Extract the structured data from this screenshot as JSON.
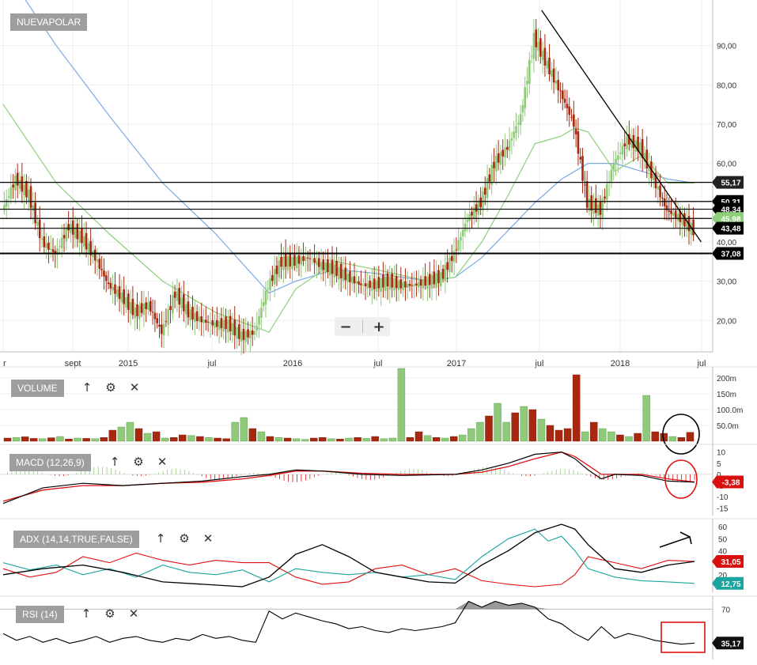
{
  "instrument": "NUEVAPOLAR",
  "colors": {
    "up": "#8fc97a",
    "down": "#a8280f",
    "sma_green": "#8cd07a",
    "sma_blue": "#79a9e6",
    "macd_line": "#000000",
    "signal_line": "#e01010",
    "adx_line": "#000000",
    "di_plus": "#1aa5a0",
    "di_minus": "#e01010",
    "rsi_line": "#000000",
    "annotation_black": "#000000",
    "annotation_red": "#e01010"
  },
  "panels": {
    "volume": {
      "label": "VOLUME"
    },
    "macd": {
      "label": "MACD (12,26,9)"
    },
    "adx": {
      "label": "ADX (14,14,TRUE,FALSE)"
    },
    "rsi": {
      "label": "RSI (14)"
    }
  },
  "toolbar": {
    "move_icon": "arrow-up-icon",
    "settings_icon": "gear-icon",
    "close_icon": "close-icon",
    "zoom_out": "−",
    "zoom_in": "+"
  },
  "chart_data": [
    {
      "name": "price",
      "type": "candlestick",
      "x_axis_labels": [
        "r",
        "sept",
        "2015",
        "jul",
        "2016",
        "jul",
        "2017",
        "jul",
        "2018",
        "jul"
      ],
      "y_ticks": [
        "20,00",
        "30,00",
        "40,00",
        "50,00",
        "60,00",
        "70,00",
        "80,00",
        "90,00"
      ],
      "ylim": [
        12,
        100
      ],
      "horizontal_levels": [
        {
          "value": 55.17,
          "label": "55,17"
        },
        {
          "value": 50.31,
          "label": "50,31"
        },
        {
          "value": 48.34,
          "label": "48,34"
        },
        {
          "value": 45.98,
          "label": "45,98"
        },
        {
          "value": 43.48,
          "label": "43,48"
        },
        {
          "value": 37.08,
          "label": "37,08"
        }
      ],
      "price_points": [
        [
          0,
          48
        ],
        [
          1,
          56
        ],
        [
          2,
          52
        ],
        [
          3,
          40
        ],
        [
          4,
          37
        ],
        [
          5,
          44
        ],
        [
          6,
          41
        ],
        [
          7,
          36
        ],
        [
          8,
          29
        ],
        [
          9,
          26
        ],
        [
          10,
          22
        ],
        [
          11,
          24
        ],
        [
          12,
          17
        ],
        [
          13,
          27
        ],
        [
          14,
          22
        ],
        [
          15,
          20
        ],
        [
          16,
          19
        ],
        [
          17,
          19
        ],
        [
          18,
          16
        ],
        [
          19,
          17
        ],
        [
          20,
          29
        ],
        [
          21,
          35
        ],
        [
          22,
          35
        ],
        [
          23,
          36
        ],
        [
          24,
          34
        ],
        [
          25,
          33
        ],
        [
          26,
          31
        ],
        [
          27,
          29
        ],
        [
          28,
          29
        ],
        [
          29,
          30
        ],
        [
          30,
          29
        ],
        [
          31,
          29
        ],
        [
          32,
          30
        ],
        [
          33,
          31
        ],
        [
          34,
          37
        ],
        [
          35,
          46
        ],
        [
          36,
          50
        ],
        [
          37,
          60
        ],
        [
          38,
          64
        ],
        [
          39,
          72
        ],
        [
          40,
          92
        ],
        [
          41,
          85
        ],
        [
          42,
          78
        ],
        [
          43,
          70
        ],
        [
          44,
          50
        ],
        [
          45,
          48
        ],
        [
          46,
          60
        ],
        [
          47,
          66
        ],
        [
          48,
          64
        ],
        [
          49,
          56
        ],
        [
          50,
          48
        ],
        [
          51,
          46
        ],
        [
          52,
          43
        ]
      ],
      "sma_green": [
        [
          0,
          75
        ],
        [
          4,
          55
        ],
        [
          8,
          42
        ],
        [
          12,
          30
        ],
        [
          16,
          22
        ],
        [
          20,
          17
        ],
        [
          22,
          28
        ],
        [
          25,
          35
        ],
        [
          28,
          33
        ],
        [
          32,
          30
        ],
        [
          34,
          31
        ],
        [
          36,
          40
        ],
        [
          38,
          52
        ],
        [
          40,
          65
        ],
        [
          42,
          67
        ],
        [
          43,
          69
        ],
        [
          44,
          68
        ],
        [
          46,
          58
        ],
        [
          48,
          62
        ],
        [
          50,
          55
        ],
        [
          52,
          55
        ]
      ],
      "sma_blue": [
        [
          0,
          110
        ],
        [
          4,
          90
        ],
        [
          8,
          72
        ],
        [
          12,
          55
        ],
        [
          16,
          42
        ],
        [
          20,
          27
        ],
        [
          22,
          30
        ],
        [
          25,
          33
        ],
        [
          28,
          32
        ],
        [
          32,
          30
        ],
        [
          34,
          31
        ],
        [
          36,
          36
        ],
        [
          38,
          43
        ],
        [
          40,
          50
        ],
        [
          42,
          56
        ],
        [
          44,
          60
        ],
        [
          46,
          60
        ],
        [
          48,
          58
        ],
        [
          50,
          56
        ],
        [
          52,
          55
        ]
      ],
      "trendline": [
        [
          40.5,
          99
        ],
        [
          52.5,
          40
        ]
      ]
    },
    {
      "name": "volume",
      "type": "bar",
      "y_ticks": [
        "200m",
        "150m",
        "100.0m",
        "50.0m"
      ],
      "ylim": [
        0,
        220
      ],
      "values": [
        10,
        12,
        14,
        9,
        8,
        11,
        15,
        7,
        10,
        9,
        8,
        12,
        35,
        45,
        60,
        40,
        25,
        30,
        10,
        12,
        20,
        18,
        15,
        12,
        10,
        8,
        60,
        75,
        40,
        30,
        15,
        12,
        10,
        8,
        6,
        10,
        12,
        8,
        7,
        10,
        12,
        9,
        15,
        8,
        10,
        230,
        12,
        30,
        18,
        12,
        10,
        15,
        20,
        40,
        60,
        80,
        120,
        60,
        90,
        110,
        100,
        70,
        50,
        35,
        40,
        210,
        30,
        60,
        40,
        30,
        20,
        15,
        25,
        145,
        30,
        25,
        15,
        12,
        28
      ],
      "up_flags": [
        0,
        1,
        0,
        0,
        1,
        0,
        1,
        0,
        1,
        0,
        1,
        0,
        0,
        1,
        1,
        0,
        1,
        0,
        1,
        0,
        0,
        1,
        0,
        1,
        0,
        0,
        1,
        1,
        0,
        1,
        0,
        1,
        0,
        1,
        1,
        0,
        0,
        1,
        0,
        1,
        0,
        1,
        0,
        1,
        1,
        1,
        0,
        0,
        1,
        0,
        1,
        0,
        1,
        1,
        1,
        0,
        1,
        1,
        0,
        1,
        0,
        1,
        0,
        0,
        0,
        0,
        1,
        0,
        1,
        1,
        0,
        1,
        0,
        1,
        0,
        0,
        1,
        0,
        0
      ]
    },
    {
      "name": "macd",
      "type": "line",
      "y_ticks": [
        "10",
        "5",
        "0",
        "-5",
        "-10",
        "-15"
      ],
      "ylim": [
        -17,
        12
      ],
      "last_value": {
        "value": -3.38,
        "label": "-3,38"
      },
      "macd": [
        [
          0,
          -13
        ],
        [
          3,
          -6
        ],
        [
          6,
          -4
        ],
        [
          9,
          -5
        ],
        [
          12,
          -4
        ],
        [
          15,
          -3
        ],
        [
          18,
          -1
        ],
        [
          20,
          0
        ],
        [
          22,
          2
        ],
        [
          24,
          1.5
        ],
        [
          27,
          0
        ],
        [
          30,
          -0.5
        ],
        [
          34,
          0
        ],
        [
          36,
          2
        ],
        [
          38,
          5
        ],
        [
          40,
          9
        ],
        [
          42,
          10
        ],
        [
          43,
          7
        ],
        [
          44,
          2
        ],
        [
          45,
          -2
        ],
        [
          46,
          0
        ],
        [
          48,
          -0.5
        ],
        [
          50,
          -3
        ],
        [
          52,
          -3.5
        ]
      ],
      "signal": [
        [
          0,
          -12
        ],
        [
          3,
          -7
        ],
        [
          6,
          -5
        ],
        [
          9,
          -5
        ],
        [
          12,
          -4
        ],
        [
          15,
          -3.5
        ],
        [
          18,
          -2
        ],
        [
          20,
          -0.5
        ],
        [
          22,
          1.5
        ],
        [
          24,
          1.5
        ],
        [
          27,
          0.5
        ],
        [
          30,
          0
        ],
        [
          34,
          0
        ],
        [
          36,
          1
        ],
        [
          38,
          3.5
        ],
        [
          40,
          7
        ],
        [
          42,
          10
        ],
        [
          43,
          8
        ],
        [
          44,
          4
        ],
        [
          45,
          0
        ],
        [
          46,
          0
        ],
        [
          48,
          0
        ],
        [
          50,
          -2
        ],
        [
          52,
          -3.4
        ]
      ]
    },
    {
      "name": "adx",
      "type": "line",
      "y_ticks": [
        "60",
        "50",
        "40",
        "30",
        "20"
      ],
      "ylim": [
        8,
        64
      ],
      "last_values": [
        {
          "value": 31.05,
          "label": "31,05"
        },
        {
          "value": 12.75,
          "label": "12,75"
        }
      ],
      "adx": [
        [
          0,
          20
        ],
        [
          3,
          25
        ],
        [
          6,
          28
        ],
        [
          9,
          22
        ],
        [
          12,
          14
        ],
        [
          15,
          12
        ],
        [
          18,
          10
        ],
        [
          20,
          18
        ],
        [
          22,
          37
        ],
        [
          24,
          45
        ],
        [
          26,
          35
        ],
        [
          28,
          22
        ],
        [
          30,
          18
        ],
        [
          32,
          14
        ],
        [
          34,
          13
        ],
        [
          36,
          28
        ],
        [
          38,
          40
        ],
        [
          40,
          55
        ],
        [
          42,
          62
        ],
        [
          43,
          58
        ],
        [
          44,
          45
        ],
        [
          45,
          35
        ],
        [
          46,
          25
        ],
        [
          48,
          22
        ],
        [
          50,
          28
        ],
        [
          52,
          31
        ]
      ],
      "di_plus": [
        [
          0,
          30
        ],
        [
          2,
          24
        ],
        [
          4,
          28
        ],
        [
          6,
          20
        ],
        [
          8,
          25
        ],
        [
          10,
          18
        ],
        [
          12,
          28
        ],
        [
          14,
          22
        ],
        [
          16,
          20
        ],
        [
          18,
          24
        ],
        [
          20,
          14
        ],
        [
          22,
          25
        ],
        [
          24,
          22
        ],
        [
          26,
          20
        ],
        [
          28,
          22
        ],
        [
          30,
          18
        ],
        [
          32,
          20
        ],
        [
          34,
          16
        ],
        [
          36,
          35
        ],
        [
          38,
          50
        ],
        [
          40,
          58
        ],
        [
          41,
          48
        ],
        [
          42,
          52
        ],
        [
          43,
          40
        ],
        [
          44,
          25
        ],
        [
          46,
          18
        ],
        [
          48,
          15
        ],
        [
          50,
          14
        ],
        [
          52,
          12.75
        ]
      ],
      "di_minus": [
        [
          0,
          25
        ],
        [
          2,
          18
        ],
        [
          4,
          22
        ],
        [
          6,
          35
        ],
        [
          8,
          30
        ],
        [
          10,
          38
        ],
        [
          12,
          32
        ],
        [
          14,
          28
        ],
        [
          16,
          32
        ],
        [
          18,
          30
        ],
        [
          20,
          30
        ],
        [
          22,
          18
        ],
        [
          24,
          12
        ],
        [
          26,
          14
        ],
        [
          28,
          25
        ],
        [
          30,
          28
        ],
        [
          32,
          20
        ],
        [
          34,
          25
        ],
        [
          36,
          15
        ],
        [
          38,
          12
        ],
        [
          40,
          10
        ],
        [
          42,
          12
        ],
        [
          43,
          20
        ],
        [
          44,
          35
        ],
        [
          46,
          30
        ],
        [
          48,
          25
        ],
        [
          50,
          32
        ],
        [
          52,
          31
        ]
      ]
    },
    {
      "name": "rsi",
      "type": "area",
      "y_ticks": [
        "70"
      ],
      "ylim": [
        20,
        80
      ],
      "last_value": {
        "value": 35.17,
        "label": "35,17"
      },
      "rsi": [
        [
          0,
          45
        ],
        [
          1,
          38
        ],
        [
          2,
          42
        ],
        [
          3,
          36
        ],
        [
          4,
          40
        ],
        [
          5,
          35
        ],
        [
          6,
          38
        ],
        [
          7,
          42
        ],
        [
          8,
          36
        ],
        [
          9,
          40
        ],
        [
          10,
          42
        ],
        [
          11,
          38
        ],
        [
          12,
          36
        ],
        [
          13,
          40
        ],
        [
          14,
          38
        ],
        [
          15,
          44
        ],
        [
          16,
          40
        ],
        [
          17,
          42
        ],
        [
          18,
          38
        ],
        [
          19,
          36
        ],
        [
          20,
          68
        ],
        [
          21,
          60
        ],
        [
          22,
          66
        ],
        [
          23,
          62
        ],
        [
          24,
          58
        ],
        [
          25,
          55
        ],
        [
          26,
          50
        ],
        [
          27,
          52
        ],
        [
          28,
          48
        ],
        [
          29,
          46
        ],
        [
          30,
          50
        ],
        [
          31,
          48
        ],
        [
          32,
          50
        ],
        [
          33,
          52
        ],
        [
          34,
          56
        ],
        [
          35,
          78
        ],
        [
          36,
          72
        ],
        [
          37,
          78
        ],
        [
          38,
          74
        ],
        [
          39,
          76
        ],
        [
          40,
          72
        ],
        [
          41,
          60
        ],
        [
          42,
          55
        ],
        [
          43,
          45
        ],
        [
          44,
          38
        ],
        [
          45,
          52
        ],
        [
          46,
          40
        ],
        [
          47,
          45
        ],
        [
          48,
          42
        ],
        [
          49,
          38
        ],
        [
          50,
          36
        ],
        [
          51,
          34
        ],
        [
          52,
          35.17
        ]
      ]
    }
  ]
}
